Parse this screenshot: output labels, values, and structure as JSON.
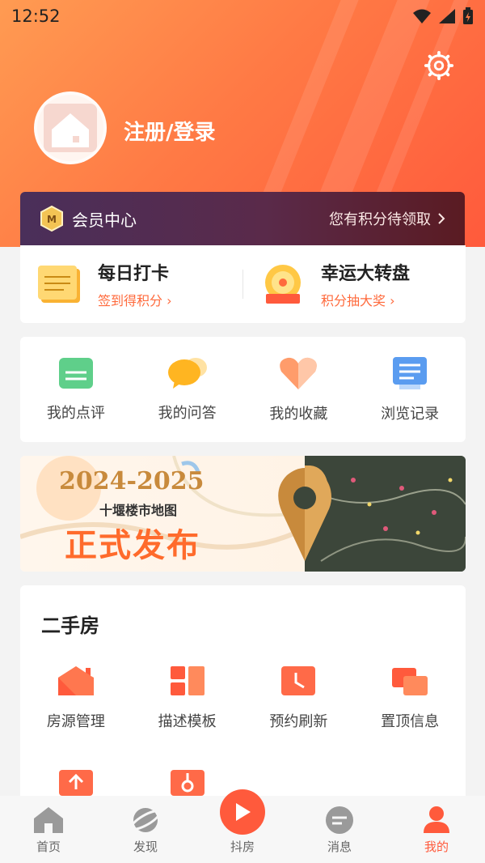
{
  "status": {
    "time": "12:52"
  },
  "header": {
    "login_text": "注册/登录"
  },
  "member": {
    "title": "会员中心",
    "points_prompt": "您有积分待领取"
  },
  "checkin": [
    {
      "title": "每日打卡",
      "sub": "签到得积分"
    },
    {
      "title": "幸运大转盘",
      "sub": "积分抽大奖"
    }
  ],
  "quick": [
    {
      "label": "我的点评",
      "icon": "comment-icon"
    },
    {
      "label": "我的问答",
      "icon": "qa-icon"
    },
    {
      "label": "我的收藏",
      "icon": "favorite-icon"
    },
    {
      "label": "浏览记录",
      "icon": "history-icon"
    }
  ],
  "banner": {
    "years": "2024-2025",
    "sub": "十堰楼市地图",
    "main": "正式发布"
  },
  "second_hand": {
    "title": "二手房",
    "items": [
      {
        "label": "房源管理",
        "icon": "house-manage-icon"
      },
      {
        "label": "描述模板",
        "icon": "template-icon"
      },
      {
        "label": "预约刷新",
        "icon": "clock-icon"
      },
      {
        "label": "置顶信息",
        "icon": "pin-top-icon"
      }
    ]
  },
  "tabs": [
    {
      "label": "首页",
      "icon": "home-icon"
    },
    {
      "label": "发现",
      "icon": "planet-icon"
    },
    {
      "label": "抖房",
      "icon": "play-icon"
    },
    {
      "label": "消息",
      "icon": "message-icon"
    },
    {
      "label": "我的",
      "icon": "user-icon"
    }
  ],
  "colors": {
    "accent": "#ff5a3c",
    "member_bg": "#4a2f5a"
  }
}
